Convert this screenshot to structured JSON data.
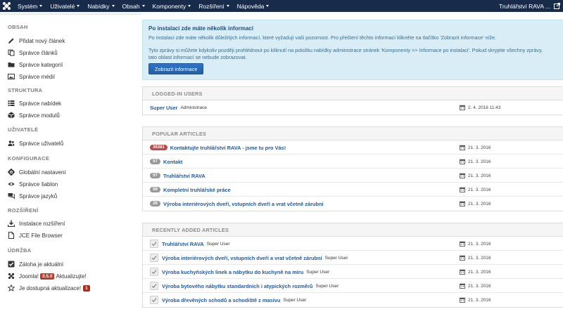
{
  "navbar": {
    "menu": [
      {
        "label": "Systém",
        "name": "menu-system"
      },
      {
        "label": "Uživatelé",
        "name": "menu-users"
      },
      {
        "label": "Nabídky",
        "name": "menu-menus"
      },
      {
        "label": "Obsah",
        "name": "menu-content"
      },
      {
        "label": "Komponenty",
        "name": "menu-components"
      },
      {
        "label": "Rozšíření",
        "name": "menu-extensions"
      },
      {
        "label": "Nápověda",
        "name": "menu-help"
      }
    ],
    "site_name": "Truhlářství RAVA ..."
  },
  "sidebar": {
    "sections": [
      {
        "heading": "OBSAH",
        "items": [
          {
            "label": "Přidat nový článek",
            "icon": "pencil-icon"
          },
          {
            "label": "Správce článků",
            "icon": "copy-icon"
          },
          {
            "label": "Správce kategorií",
            "icon": "folder-icon"
          },
          {
            "label": "Správce médií",
            "icon": "image-icon"
          }
        ]
      },
      {
        "heading": "STRUKTURA",
        "items": [
          {
            "label": "Správce nabídek",
            "icon": "list-icon"
          },
          {
            "label": "Správce modulů",
            "icon": "cube-icon"
          }
        ]
      },
      {
        "heading": "UŽIVATELÉ",
        "items": [
          {
            "label": "Správce uživatelů",
            "icon": "users-icon"
          }
        ]
      },
      {
        "heading": "KONFIGURACE",
        "items": [
          {
            "label": "Globální nastavení",
            "icon": "gear-icon"
          },
          {
            "label": "Správce šablon",
            "icon": "eye-icon"
          },
          {
            "label": "Správce jazyků",
            "icon": "comments-icon"
          }
        ]
      },
      {
        "heading": "ROZŠÍŘENÍ",
        "items": [
          {
            "label": "Instalace rozšíření",
            "icon": "download-icon"
          },
          {
            "label": "JCE File Browser",
            "icon": "file-icon"
          }
        ]
      },
      {
        "heading": "ÚDRŽBA",
        "items": [
          {
            "label": "Záloha je aktuální",
            "icon": "check-icon"
          }
        ]
      }
    ],
    "joomla": {
      "label_pre": "Joomla!",
      "version": "3.5.0",
      "label_post": "Aktualizujte!"
    },
    "updates": {
      "label": "Je dostupná aktualizace!",
      "count": "1"
    }
  },
  "info": {
    "title": "Po instalaci zde máte několik informací",
    "p1": "Po instalaci zde máte několik důležitých informací, které vyžadují vaši pozornost. Pro přečtení těchto informací klikněte na tlačítko 'Zobrazit informace' níže.",
    "p2a": "Tyto zprávy si můžete kdykoliv později prohlédnout po kliknutí na položku nabídky administrace stránek 'Komponenty >> Informace po instalaci'. Pokud skryjete všechny zprávy,",
    "p2b": "tato oblast informací se nebude zobrazovat.",
    "button": "Zobrazit informace"
  },
  "logged_in": {
    "heading": "LOGGED-IN USERS",
    "rows": [
      {
        "name": "Super User",
        "role": "Administrace",
        "date": "2. 4. 2016 11:43"
      }
    ]
  },
  "popular": {
    "heading": "POPULAR ARTICLES",
    "rows": [
      {
        "hits": "36381",
        "title": "Kontaktujte truhlářství RAVA - jsme tu pro Vás!",
        "date": "21. 3. 2016",
        "hot": true
      },
      {
        "hits": "57",
        "title": "Kontakt",
        "date": "21. 3. 2016",
        "hot": false
      },
      {
        "hits": "57",
        "title": "Truhlářství RAVA",
        "date": "21. 3. 2016",
        "hot": false
      },
      {
        "hits": "56",
        "title": "Kompletní truhlářské práce",
        "date": "21. 3. 2016",
        "hot": false
      },
      {
        "hits": "26",
        "title": "Výroba interiérových dveří, vstupních dveří a vrat včetně zárubní",
        "date": "21. 3. 2016",
        "hot": false
      }
    ]
  },
  "recent": {
    "heading": "RECENTLY ADDED ARTICLES",
    "rows": [
      {
        "title": "Truhlářství RAVA",
        "author": "Super User",
        "date": "21. 3. 2016"
      },
      {
        "title": "Výroba interiérových dveří, vstupních dveří a vrat včetně zárubní",
        "author": "Super User",
        "date": "21. 3. 2016"
      },
      {
        "title": "Výroba kuchyňských linek a nábytku do kuchyně na míru",
        "author": "Super User",
        "date": "21. 3. 2016"
      },
      {
        "title": "Výroba bytového nábytku standardních i atypických rozměrů",
        "author": "Super User",
        "date": "21. 3. 2016"
      },
      {
        "title": "Výroba dřevěných schodů a schodiště z masivu",
        "author": "Super User",
        "date": "21. 3. 2016"
      }
    ]
  },
  "colors": {
    "navbar": "#182b4a",
    "link": "#1f5aa8",
    "info_bg": "#d9edf7",
    "button": "#2a69b8",
    "hot_badge": "#b94a48"
  }
}
